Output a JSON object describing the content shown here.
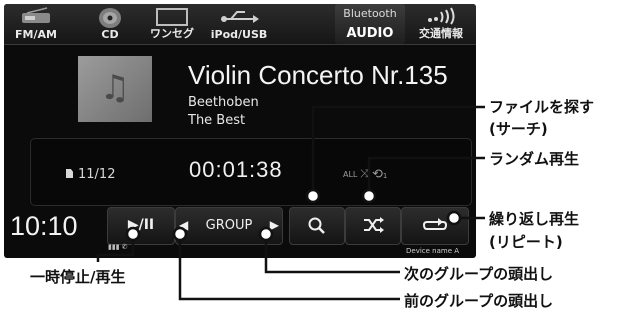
{
  "sources": [
    {
      "id": "fm",
      "label": "FM/AM",
      "icon": "radio-icon"
    },
    {
      "id": "cd",
      "label": "CD",
      "icon": "disc-icon"
    },
    {
      "id": "tv",
      "label": "ワンセグ",
      "icon": "tv-icon"
    },
    {
      "id": "ipod",
      "label": "iPod/USB",
      "icon": "usb-icon"
    },
    {
      "id": "bt",
      "label_line1": "Bluetooth",
      "label_line2": "AUDIO",
      "icon": "bluetooth-icon",
      "selected": true
    },
    {
      "id": "traffic",
      "label": "交通情報",
      "icon": "signal-icon"
    }
  ],
  "now_playing": {
    "title": "Violin Concerto Nr.135",
    "artist": "Beethoben",
    "album": "The Best",
    "album_art_icon": "music-note-icon",
    "track_count": "11/12",
    "elapsed": "00:01:38",
    "random_label": "ALL",
    "repeat_label": "1"
  },
  "controls": {
    "clock": "10:10",
    "play_pause_label": "▶/II",
    "group_label": "GROUP",
    "group_prev_label": "◀",
    "group_next_label": "▶",
    "search_icon": "search-icon",
    "shuffle_icon": "shuffle-icon",
    "repeat_icon": "repeat-icon",
    "device_name": "Device name A"
  },
  "callouts": {
    "search": "ファイルを探す",
    "search_sub": "(サーチ)",
    "random": "ランダム再生",
    "repeat": "繰り返し再生",
    "repeat_sub": "(リピート)",
    "pause_play": "一時停止/再生",
    "next_group": "次のグループの頭出し",
    "prev_group": "前のグループの頭出し"
  }
}
